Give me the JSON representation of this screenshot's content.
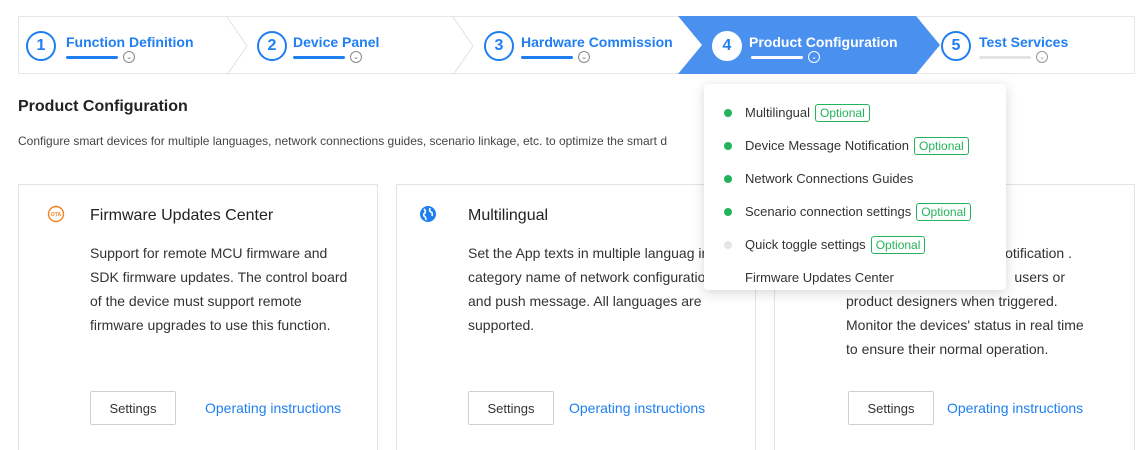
{
  "stepper": {
    "steps": [
      {
        "number": "1",
        "label": "Function Definition",
        "state": "done"
      },
      {
        "number": "2",
        "label": "Device Panel",
        "state": "done"
      },
      {
        "number": "3",
        "label": "Hardware Commission",
        "state": "done"
      },
      {
        "number": "4",
        "label": "Product Configuration",
        "state": "active"
      },
      {
        "number": "5",
        "label": "Test Services",
        "state": "pending"
      }
    ],
    "caret_glyph": "⌄"
  },
  "page": {
    "title": "Product Configuration",
    "description": "Configure smart devices for multiple languages, network connections guides, scenario linkage, etc. to optimize the smart d"
  },
  "cards": [
    {
      "icon": "ota-icon",
      "title": "Firmware Updates Center",
      "description": "Support for remote MCU firmware and SDK firmware updates. The control board of the device must support remote firmware upgrades to use this function.",
      "settings_label": "Settings",
      "link_label": "Operating instructions"
    },
    {
      "icon": "globe-icon",
      "title": "Multilingual",
      "description": "Set the App texts in multiple languag incl. category name of network configuration and push message. All languages are supported.",
      "settings_label": "Settings",
      "link_label": "Operating instructions"
    },
    {
      "icon": "notification-icon",
      "title": "",
      "description_lines": [
        "notification .",
        "users or",
        "product designers when triggered.",
        "Monitor the devices' status in real time",
        "to ensure their normal operation."
      ],
      "settings_label": "Settings",
      "link_label": "Operating instructions"
    }
  ],
  "dropdown": {
    "optional_label": "Optional",
    "items": [
      {
        "label": "Multilingual",
        "status": "done",
        "optional": true
      },
      {
        "label": "Device Message Notification",
        "status": "done",
        "optional": true
      },
      {
        "label": "Network Connections Guides",
        "status": "done",
        "optional": false
      },
      {
        "label": "Scenario connection settings",
        "status": "done",
        "optional": true
      },
      {
        "label": "Quick toggle settings",
        "status": "todo",
        "optional": true
      },
      {
        "label": "Firmware Updates Center",
        "status": "none",
        "optional": false
      }
    ]
  },
  "colors": {
    "accent": "#1f7ff1",
    "success": "#23b35a",
    "border": "#e3e3e3"
  }
}
